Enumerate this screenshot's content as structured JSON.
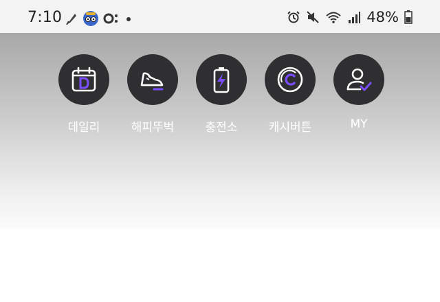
{
  "status_bar": {
    "time": "7:10",
    "battery_percent": "48%",
    "left_icons": [
      "quill-icon",
      "character-avatar-icon",
      "chat-app-icon",
      "dot-icon"
    ],
    "right_icons": [
      "alarm-icon",
      "mute-icon",
      "wifi-icon",
      "signal-icon",
      "battery-icon"
    ]
  },
  "menu": {
    "items": [
      {
        "label": "데일리",
        "icon": "calendar-d-icon"
      },
      {
        "label": "해피뚜벅",
        "icon": "sneaker-icon"
      },
      {
        "label": "충전소",
        "icon": "battery-bolt-icon"
      },
      {
        "label": "캐시버튼",
        "icon": "coin-c-icon"
      },
      {
        "label": "MY",
        "icon": "user-check-icon"
      }
    ]
  },
  "colors": {
    "accent": "#7b4dff",
    "circle": "#2f2f31",
    "label": "#ffffff"
  }
}
